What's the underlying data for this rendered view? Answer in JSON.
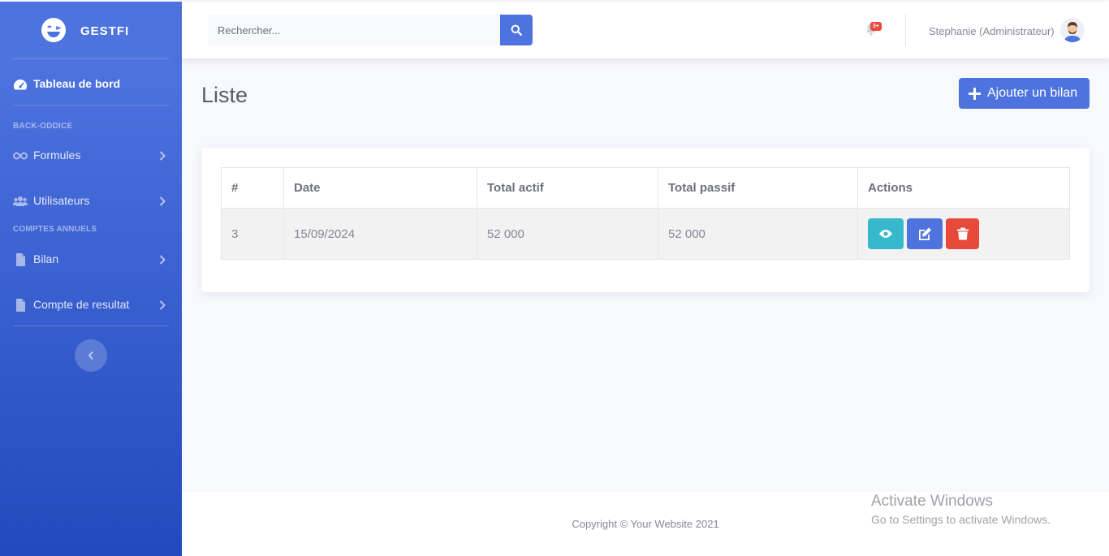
{
  "brand": {
    "name": "GESTFI"
  },
  "sidebar": {
    "dashboard": "Tableau de bord",
    "heading_back_office": "BACK-ODDICE",
    "heading_annual": "COMPTES ANNUELS",
    "items": [
      {
        "label": "Formules",
        "icon": "infinity-icon"
      },
      {
        "label": "Utilisateurs",
        "icon": "users-icon"
      },
      {
        "label": "Bilan",
        "icon": "file-icon"
      },
      {
        "label": "Compte de resultat",
        "icon": "file-icon"
      }
    ]
  },
  "topbar": {
    "search_placeholder": "Rechercher...",
    "alert_badge": "3+",
    "user_name": "Stephanie (Administrateur)"
  },
  "page": {
    "title": "Liste",
    "add_button": "Ajouter un bilan"
  },
  "table": {
    "headers": [
      "#",
      "Date",
      "Total actif",
      "Total passif",
      "Actions"
    ],
    "rows": [
      {
        "id": "3",
        "date": "15/09/2024",
        "total_actif": "52 000",
        "total_passif": "52 000"
      }
    ]
  },
  "footer": {
    "copyright": "Copyright © Your Website 2021"
  },
  "watermark": {
    "title": "Activate Windows",
    "subtitle": "Go to Settings to activate Windows."
  },
  "colors": {
    "primary": "#4e73df",
    "info": "#36b9cc",
    "danger": "#e74a3b"
  }
}
